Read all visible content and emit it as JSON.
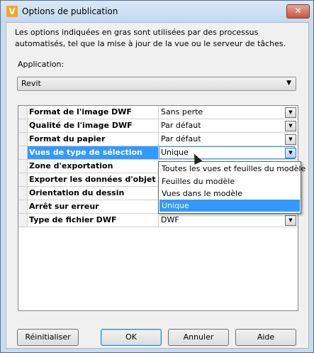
{
  "window": {
    "title": "Options de publication",
    "app_icon_glyph": "V",
    "close_glyph": "✕"
  },
  "description": "Les options indiquées en gras sont utilisées par des processus automatisés, tel que la mise à jour de la vue ou le serveur de tâches.",
  "application": {
    "label": "Application:",
    "selected": "Revit"
  },
  "properties": [
    {
      "name": "Format de l'image DWF",
      "value": "Sans perte"
    },
    {
      "name": "Qualité de l'image DWF",
      "value": "Par défaut"
    },
    {
      "name": "Format du papier",
      "value": "Par défaut"
    },
    {
      "name": "Vues de type de sélection",
      "value": "Unique"
    },
    {
      "name": "Zone d'exportation",
      "value": ""
    },
    {
      "name": "Exporter les données d'objet",
      "value": ""
    },
    {
      "name": "Orientation du dessin",
      "value": ""
    },
    {
      "name": "Arrêt sur erreur",
      "value": ""
    },
    {
      "name": "Type de fichier DWF",
      "value": "DWF"
    }
  ],
  "dropdown_options": [
    "Toutes les vues et feuilles du modèle",
    "Feuilles du modèle",
    "Vues dans le modèle",
    "Unique"
  ],
  "buttons": {
    "reset": "Réinitialiser",
    "ok": "OK",
    "cancel": "Annuler",
    "help": "Aide"
  },
  "icons": {
    "dropdown_arrow": "▼",
    "app_dropdown_arrow": "▼"
  },
  "colors": {
    "selection": "#3399ff",
    "title_bar": "#c9dcef",
    "app_icon": "#f5a623"
  }
}
